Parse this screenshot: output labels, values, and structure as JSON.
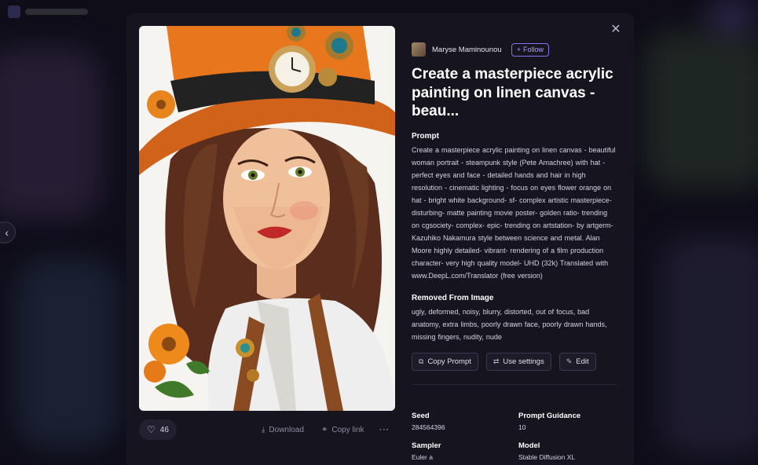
{
  "author": {
    "name": "Maryse Maminounou",
    "follow_label": "Follow"
  },
  "title": "Create a masterpiece acrylic painting on linen canvas - beau...",
  "prompt": {
    "heading": "Prompt",
    "text": "Create a masterpiece acrylic painting on linen canvas - beautiful woman portrait - steampunk style (Pete Amachree) with hat - perfect eyes and face - detailed hands and hair in high resolution - cinematic lighting - focus on eyes flower orange on hat - bright white background- sf- complex artistic masterpiece- disturbing- matte painting movie poster- golden ratio- trending on cgsociety- complex- epic- trending on artstation- by artgerm-Kazuhiko Nakamura style between science and metal. Alan Moore highly detailed- vibrant- rendering of a film production character- very high quality model- UHD (32k) Translated with www.DeepL.com/Translator (free version)"
  },
  "removed": {
    "heading": "Removed From Image",
    "text": "ugly, deformed, noisy, blurry, distorted, out of focus, bad anatomy, extra limbs, poorly drawn face, poorly drawn hands, missing fingers, nudity, nude"
  },
  "buttons": {
    "copy_prompt": "Copy Prompt",
    "use_settings": "Use settings",
    "edit": "Edit"
  },
  "image_actions": {
    "likes": "46",
    "download": "Download",
    "copy_link": "Copy link",
    "more": "···"
  },
  "meta": {
    "seed_label": "Seed",
    "seed": "284564396",
    "guidance_label": "Prompt Guidance",
    "guidance": "10",
    "sampler_label": "Sampler",
    "sampler": "Euler a",
    "model_label": "Model",
    "model": "Stable Diffusion XL"
  },
  "icons": {
    "close": "close-icon",
    "heart": "heart-icon",
    "download": "download-icon",
    "link": "link-icon",
    "copy": "copy-icon",
    "settings": "settings-icon",
    "edit": "edit-icon",
    "back": "chevron-left-icon",
    "plus": "plus-icon"
  },
  "colors": {
    "accent": "#7f75f0",
    "modal_bg": "#16151f",
    "page_bg": "#0e0d18",
    "hat": "#e8761c"
  }
}
